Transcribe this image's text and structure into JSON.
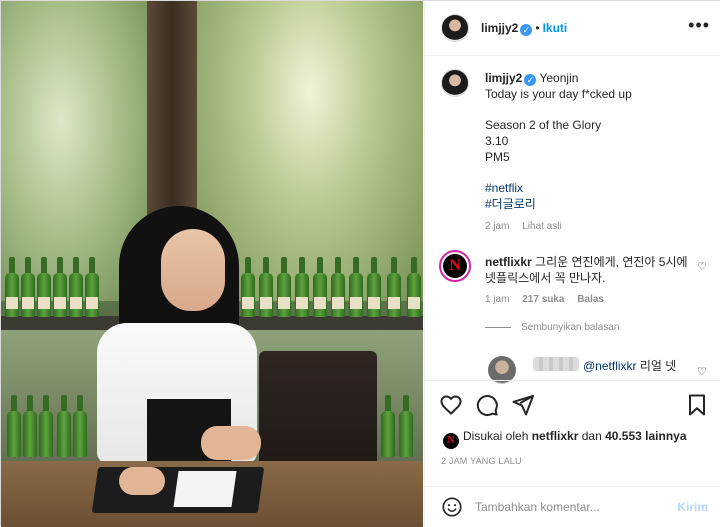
{
  "post": {
    "header": {
      "username": "limjjy2",
      "verified_mark": "✓",
      "separator": "•",
      "follow_label": "Ikuti",
      "more_icon": "more-horizontal-icon"
    },
    "caption": {
      "username": "limjjy2",
      "tag": "Yeonjin",
      "lines": [
        "Today is your day f*cked up",
        "",
        "Season 2 of the Glory",
        "3.10",
        "PM5",
        "",
        "#netflix",
        "#더글로리"
      ],
      "time": "2 jam",
      "translate_label": "Lihat asli"
    },
    "comment": {
      "avatar_letter": "N",
      "username": "netflixkr",
      "text": "그리운 연진에게, 연진아 5시에 넷플릭스에서 꼭 만나자.",
      "time": "1 jam",
      "likes": "217 suka",
      "reply_label": "Balas",
      "hide_replies_label": "Sembunyikan balasan"
    },
    "reply": {
      "mention": "@netflixkr",
      "text": "리얼 넷"
    },
    "likes": {
      "avatar_letter": "N",
      "prefix": "Disukai oleh",
      "user": "netflixkr",
      "conjunction": "dan",
      "count": "40.553 lainnya"
    },
    "timestamp": "2 JAM YANG LALU",
    "composer": {
      "placeholder": "Tambahkan komentar...",
      "post_label": "Kirim"
    }
  },
  "colors": {
    "link_blue": "#0095f6",
    "hashtag": "#00376b",
    "muted": "#8e8e8e",
    "verified": "#3897f0",
    "netflix_red": "#e50914"
  }
}
